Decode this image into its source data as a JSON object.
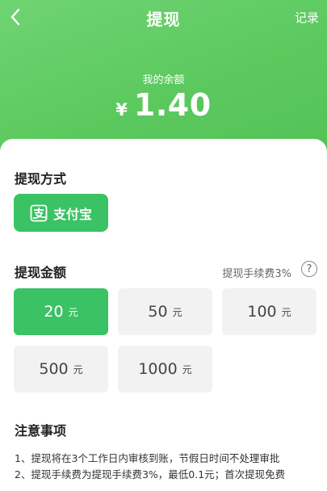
{
  "header": {
    "title": "提现",
    "records_label": "记录",
    "balance_label": "我的余额",
    "currency_symbol": "¥",
    "balance_value": "1.40"
  },
  "method": {
    "section_title": "提现方式",
    "selected_label": "支付宝",
    "icon": "alipay-icon"
  },
  "amount": {
    "section_title": "提现金额",
    "fee_text": "提现手续费3%",
    "help_symbol": "?",
    "unit": "元",
    "options": [
      {
        "value": "20",
        "selected": true
      },
      {
        "value": "50",
        "selected": false
      },
      {
        "value": "100",
        "selected": false
      },
      {
        "value": "500",
        "selected": false
      },
      {
        "value": "1000",
        "selected": false
      }
    ]
  },
  "notes": {
    "section_title": "注意事项",
    "items": [
      "1、提现将在3个工作日内审核到账，节假日时间不处理审批",
      "2、提现手续费为提现手续费3%，最低0.1元；首次提现免费"
    ]
  },
  "colors": {
    "header_green": "#5cc95f",
    "button_green": "#3bc264",
    "option_bg": "#f2f2f2"
  }
}
